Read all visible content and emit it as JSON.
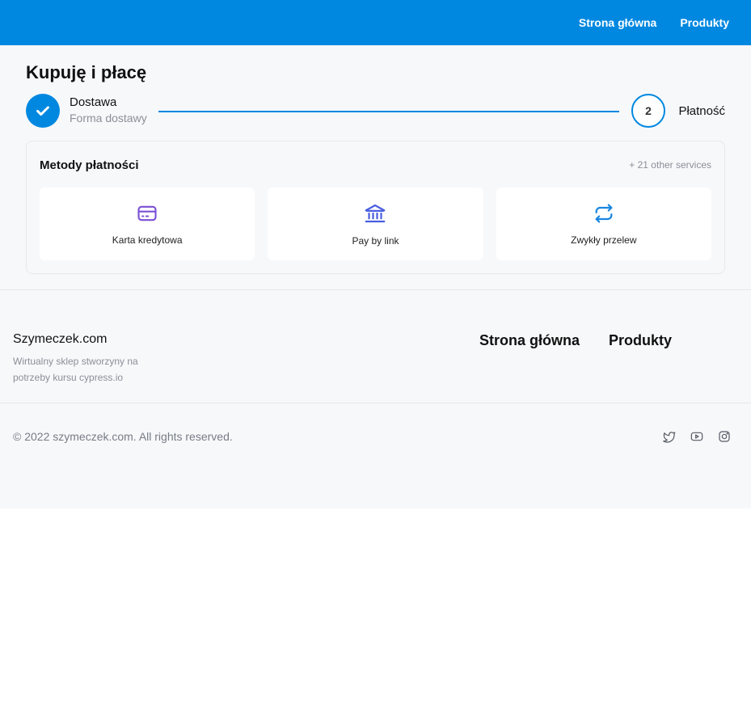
{
  "nav": {
    "home": "Strona główna",
    "products": "Produkty"
  },
  "page_title": "Kupuję i płacę",
  "stepper": {
    "step1": {
      "label": "Dostawa",
      "sub": "Forma dostawy",
      "icon": "check-icon"
    },
    "step2": {
      "number": "2",
      "label": "Płatność"
    }
  },
  "payment": {
    "title": "Metody płatności",
    "extra": "+ 21 other services",
    "methods": [
      {
        "label": "Karta kredytowa",
        "icon": "credit-card-icon",
        "color": "#7b4fd6"
      },
      {
        "label": "Pay by link",
        "icon": "bank-icon",
        "color": "#4a5fe0"
      },
      {
        "label": "Zwykły przelew",
        "icon": "transfer-icon",
        "color": "#1a86e0"
      }
    ]
  },
  "footer": {
    "brand": "Szymeczek.com",
    "description": "Wirtualny sklep stworzyny na potrzeby kursu cypress.io",
    "nav": {
      "home": "Strona główna",
      "products": "Produkty"
    },
    "copyright": "© 2022 szymeczek.com. All rights reserved.",
    "socials": [
      "twitter-icon",
      "youtube-icon",
      "instagram-icon"
    ]
  },
  "colors": {
    "primary": "#0088e0",
    "background": "#f7f8fa"
  }
}
